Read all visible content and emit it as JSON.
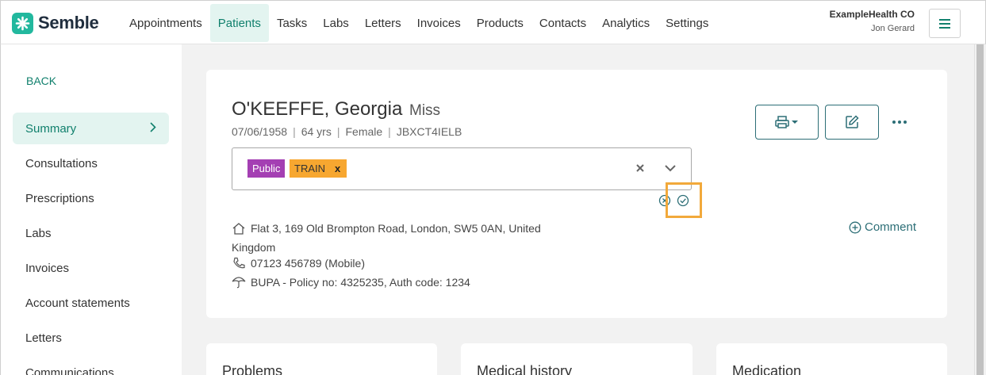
{
  "brand": {
    "name": "Semble",
    "color": "#22b89e"
  },
  "nav": {
    "items": [
      {
        "label": "Appointments"
      },
      {
        "label": "Patients",
        "active": true
      },
      {
        "label": "Tasks"
      },
      {
        "label": "Labs"
      },
      {
        "label": "Letters"
      },
      {
        "label": "Invoices"
      },
      {
        "label": "Products"
      },
      {
        "label": "Contacts"
      },
      {
        "label": "Analytics"
      },
      {
        "label": "Settings"
      }
    ]
  },
  "account": {
    "org": "ExampleHealth CO",
    "user": "Jon Gerard",
    "menu_icon": "hamburger-icon"
  },
  "sidebar": {
    "back_label": "BACK",
    "items": [
      {
        "label": "Summary",
        "active": true
      },
      {
        "label": "Consultations"
      },
      {
        "label": "Prescriptions"
      },
      {
        "label": "Labs"
      },
      {
        "label": "Invoices"
      },
      {
        "label": "Account statements"
      },
      {
        "label": "Letters"
      },
      {
        "label": "Communications"
      }
    ]
  },
  "patient": {
    "name": "O'KEEFFE, Georgia",
    "title": "Miss",
    "dob": "07/06/1958",
    "age": "64 yrs",
    "gender": "Female",
    "id": "JBXCT4IELB",
    "labels": [
      {
        "text": "Public",
        "color": "#a43fb3"
      },
      {
        "text": "TRAIN",
        "color": "#f7a730",
        "remove": "x"
      }
    ],
    "address": "Flat 3, 169 Old Brompton Road, London, SW5 0AN, United Kingdom",
    "phone": "07123 456789 (Mobile)",
    "insurance": "BUPA - Policy no: 4325235, Auth code: 1234"
  },
  "actions": {
    "comment_label": "Comment",
    "print_icon": "printer-icon",
    "edit_icon": "edit-icon",
    "more_icon": "more-icon"
  },
  "sections": [
    {
      "title": "Problems"
    },
    {
      "title": "Medical history"
    },
    {
      "title": "Medication"
    }
  ],
  "colors": {
    "accent": "#11806d",
    "highlight": "#f2a93b",
    "button_border": "#2c6e76"
  }
}
